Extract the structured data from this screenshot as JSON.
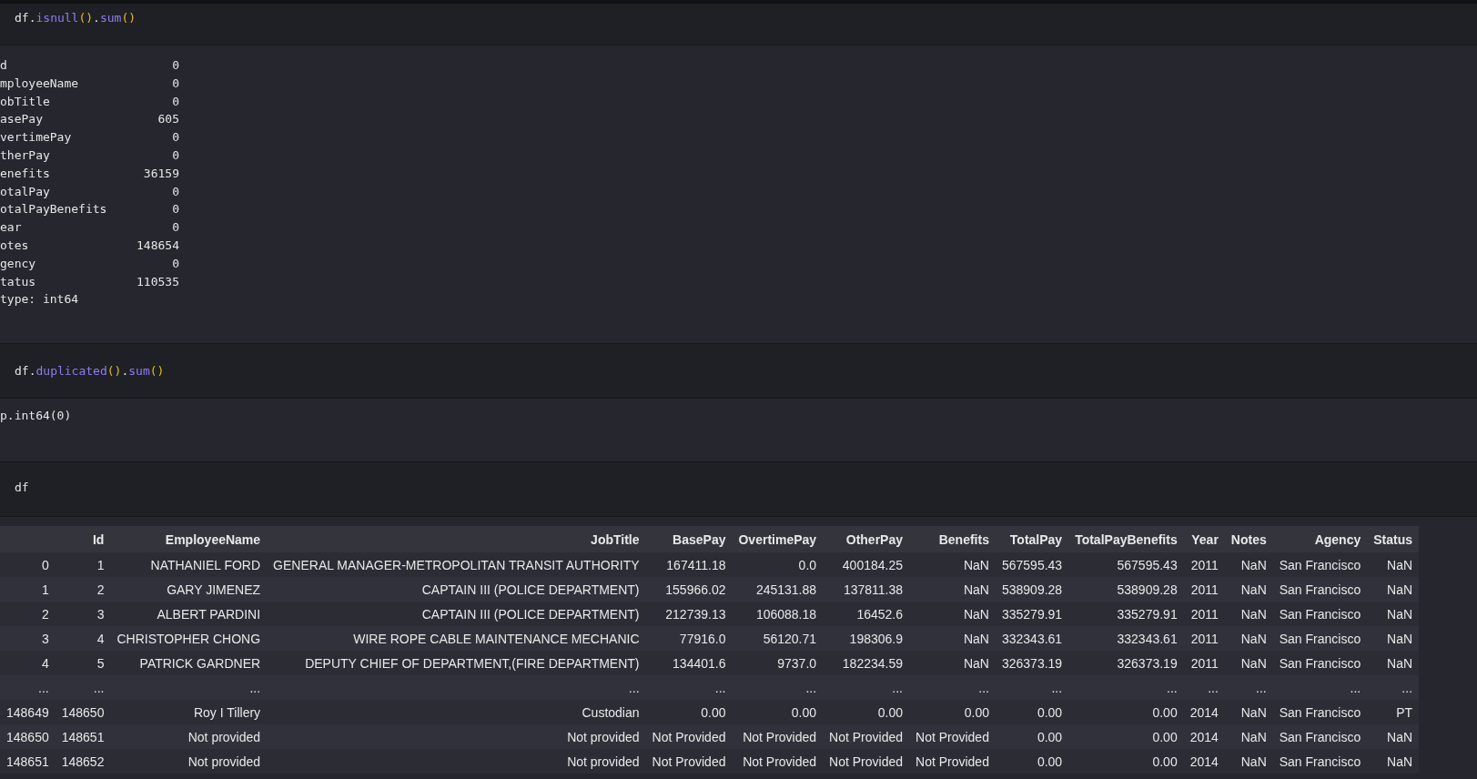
{
  "cells": [
    {
      "input": [
        {
          "text": "df.",
          "kind": "plain"
        },
        {
          "text": "isnull",
          "kind": "method"
        },
        {
          "text": "()",
          "kind": "paren"
        },
        {
          "text": ".",
          "kind": "plain"
        },
        {
          "text": "sum",
          "kind": "method"
        },
        {
          "text": "()",
          "kind": "paren"
        }
      ],
      "output": {
        "kind": "series",
        "rows": [
          {
            "label": "d",
            "value": "0"
          },
          {
            "label": "mployeeName",
            "value": "0"
          },
          {
            "label": "obTitle",
            "value": "0"
          },
          {
            "label": "asePay",
            "value": "605"
          },
          {
            "label": "vertimePay",
            "value": "0"
          },
          {
            "label": "therPay",
            "value": "0"
          },
          {
            "label": "enefits",
            "value": "36159"
          },
          {
            "label": "otalPay",
            "value": "0"
          },
          {
            "label": "otalPayBenefits",
            "value": "0"
          },
          {
            "label": "ear",
            "value": "0"
          },
          {
            "label": "otes",
            "value": "148654"
          },
          {
            "label": "gency",
            "value": "0"
          },
          {
            "label": "tatus",
            "value": "110535"
          }
        ],
        "footer": "type: int64"
      }
    },
    {
      "input": [
        {
          "text": "df.",
          "kind": "plain"
        },
        {
          "text": "duplicated",
          "kind": "method"
        },
        {
          "text": "()",
          "kind": "paren"
        },
        {
          "text": ".",
          "kind": "plain"
        },
        {
          "text": "sum",
          "kind": "method"
        },
        {
          "text": "()",
          "kind": "paren"
        }
      ],
      "output": {
        "kind": "text",
        "text": "p.int64(0)"
      }
    },
    {
      "input": [
        {
          "text": "df",
          "kind": "plain"
        }
      ],
      "output": {
        "kind": "table",
        "columns": [
          "Id",
          "EmployeeName",
          "JobTitle",
          "BasePay",
          "OvertimePay",
          "OtherPay",
          "Benefits",
          "TotalPay",
          "TotalPayBenefits",
          "Year",
          "Notes",
          "Agency",
          "Status"
        ],
        "rows": [
          {
            "index": "0",
            "cells": [
              "1",
              "NATHANIEL FORD",
              "GENERAL MANAGER-METROPOLITAN TRANSIT AUTHORITY",
              "167411.18",
              "0.0",
              "400184.25",
              "NaN",
              "567595.43",
              "567595.43",
              "2011",
              "NaN",
              "San Francisco",
              "NaN"
            ]
          },
          {
            "index": "1",
            "cells": [
              "2",
              "GARY JIMENEZ",
              "CAPTAIN III (POLICE DEPARTMENT)",
              "155966.02",
              "245131.88",
              "137811.38",
              "NaN",
              "538909.28",
              "538909.28",
              "2011",
              "NaN",
              "San Francisco",
              "NaN"
            ]
          },
          {
            "index": "2",
            "cells": [
              "3",
              "ALBERT PARDINI",
              "CAPTAIN III (POLICE DEPARTMENT)",
              "212739.13",
              "106088.18",
              "16452.6",
              "NaN",
              "335279.91",
              "335279.91",
              "2011",
              "NaN",
              "San Francisco",
              "NaN"
            ]
          },
          {
            "index": "3",
            "cells": [
              "4",
              "CHRISTOPHER CHONG",
              "WIRE ROPE CABLE MAINTENANCE MECHANIC",
              "77916.0",
              "56120.71",
              "198306.9",
              "NaN",
              "332343.61",
              "332343.61",
              "2011",
              "NaN",
              "San Francisco",
              "NaN"
            ]
          },
          {
            "index": "4",
            "cells": [
              "5",
              "PATRICK GARDNER",
              "DEPUTY CHIEF OF DEPARTMENT,(FIRE DEPARTMENT)",
              "134401.6",
              "9737.0",
              "182234.59",
              "NaN",
              "326373.19",
              "326373.19",
              "2011",
              "NaN",
              "San Francisco",
              "NaN"
            ]
          },
          {
            "index": "...",
            "cells": [
              "...",
              "...",
              "...",
              "...",
              "...",
              "...",
              "...",
              "...",
              "...",
              "...",
              "...",
              "...",
              "..."
            ]
          },
          {
            "index": "148649",
            "cells": [
              "148650",
              "Roy I Tillery",
              "Custodian",
              "0.00",
              "0.00",
              "0.00",
              "0.00",
              "0.00",
              "0.00",
              "2014",
              "NaN",
              "San Francisco",
              "PT"
            ]
          },
          {
            "index": "148650",
            "cells": [
              "148651",
              "Not provided",
              "Not provided",
              "Not Provided",
              "Not Provided",
              "Not Provided",
              "Not Provided",
              "0.00",
              "0.00",
              "2014",
              "NaN",
              "San Francisco",
              "NaN"
            ]
          },
          {
            "index": "148651",
            "cells": [
              "148652",
              "Not provided",
              "Not provided",
              "Not Provided",
              "Not Provided",
              "Not Provided",
              "Not Provided",
              "0.00",
              "0.00",
              "2014",
              "NaN",
              "San Francisco",
              "NaN"
            ]
          }
        ]
      }
    }
  ]
}
